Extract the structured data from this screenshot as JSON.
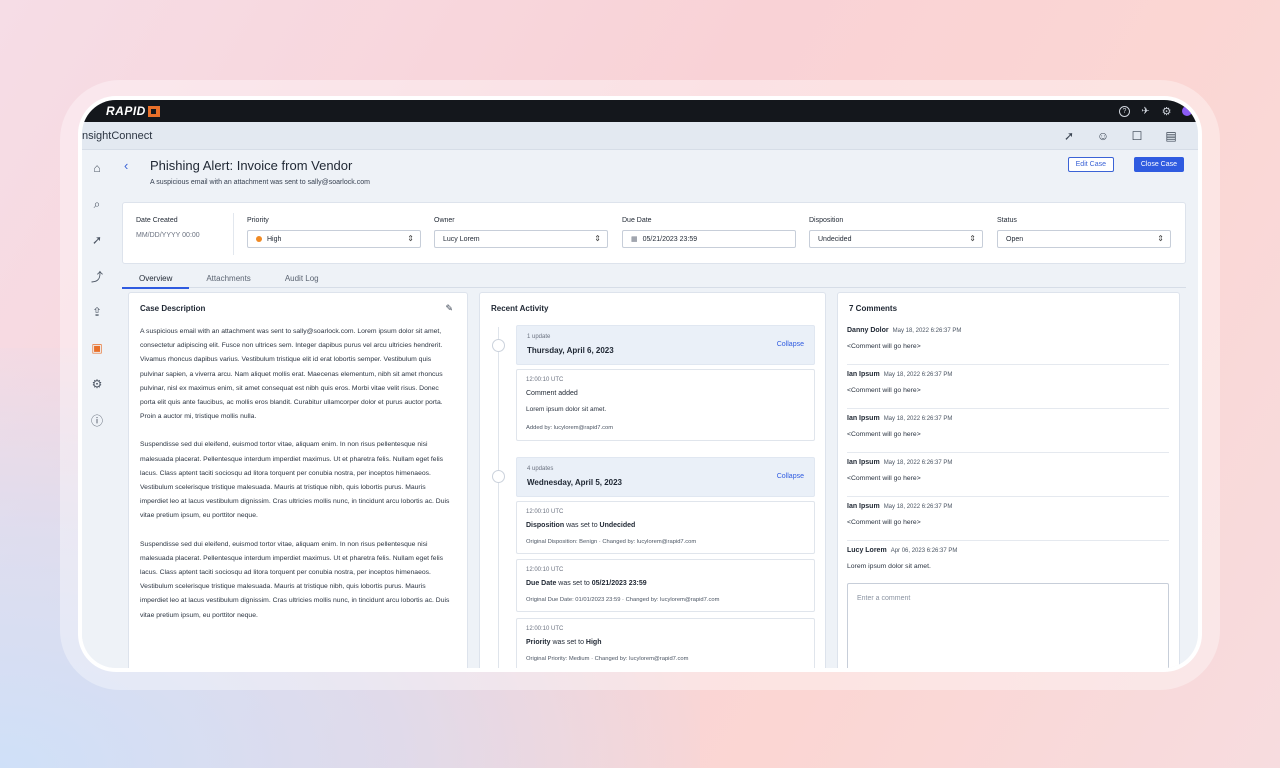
{
  "topbar": {
    "logo": "RAPID",
    "icons": [
      "help-icon",
      "rocket-icon",
      "settings-icon"
    ]
  },
  "app": {
    "name": "nsightConnect",
    "header_icons": [
      "cursor-icon",
      "user-add-icon",
      "chat-icon",
      "keyboard-icon"
    ]
  },
  "sidebar": {
    "icons": [
      "home-icon",
      "search-icon",
      "cursor-icon",
      "workflow-icon",
      "export-icon",
      "briefcase-icon",
      "gear-icon",
      "help-icon"
    ],
    "active": "briefcase-icon"
  },
  "case": {
    "title": "Phishing Alert: Invoice from Vendor",
    "subtitle": "A suspicious email with an attachment was sent to sally@soarlock.com",
    "edit_label": "Edit Case",
    "close_label": "Close Case"
  },
  "fields": {
    "date_created_label": "Date Created",
    "date_created_value": "MM/DD/YYYY 00:00",
    "priority_label": "Priority",
    "priority_value": "High",
    "priority_color": "#f08a24",
    "owner_label": "Owner",
    "owner_value": "Lucy Lorem",
    "due_label": "Due Date",
    "due_value": "05/21/2023 23:59",
    "disposition_label": "Disposition",
    "disposition_value": "Undecided",
    "status_label": "Status",
    "status_value": "Open"
  },
  "tabs": [
    "Overview",
    "Attachments",
    "Audit Log"
  ],
  "description": {
    "title": "Case Description",
    "paragraphs": [
      "A suspicious email with an attachment was sent to sally@soarlock.com. Lorem ipsum dolor sit amet, consectetur adipiscing elit. Fusce non ultrices sem. Integer dapibus purus vel arcu ultricies hendrerit. Vivamus rhoncus dapibus varius. Vestibulum tristique elit id erat lobortis semper. Vestibulum quis pulvinar sapien, a viverra arcu. Nam aliquet mollis erat. Maecenas elementum, nibh sit amet rhoncus pulvinar, nisl ex maximus enim, sit amet consequat est nibh quis eros. Morbi vitae velit risus. Donec porta elit quis ante faucibus, ac mollis eros blandit. Curabitur ullamcorper dolor et purus auctor porta. Proin a auctor mi, tristique mollis nulla.",
      "Suspendisse sed dui eleifend, euismod tortor vitae, aliquam enim. In non risus pellentesque nisi malesuada placerat. Pellentesque interdum imperdiet maximus. Ut et pharetra felis. Nullam eget felis lacus. Class aptent taciti sociosqu ad litora torquent per conubia nostra, per inceptos himenaeos. Vestibulum scelerisque tristique malesuada. Mauris at tristique nibh, quis lobortis purus. Mauris imperdiet leo at lacus vestibulum dignissim. Cras ultricies mollis nunc, in tincidunt arcu lobortis ac. Duis vitae pretium ipsum, eu porttitor neque.",
      "Suspendisse sed dui eleifend, euismod tortor vitae, aliquam enim. In non risus pellentesque nisi malesuada placerat. Pellentesque interdum imperdiet maximus. Ut et pharetra felis. Nullam eget felis lacus. Class aptent taciti sociosqu ad litora torquent per conubia nostra, per inceptos himenaeos. Vestibulum scelerisque tristique malesuada. Mauris at tristique nibh, quis lobortis purus. Mauris imperdiet leo at lacus vestibulum dignissim. Cras ultricies mollis nunc, in tincidunt arcu lobortis ac. Duis vitae pretium ipsum, eu porttitor neque."
    ]
  },
  "activity": {
    "title": "Recent Activity",
    "collapse_label": "Collapse",
    "group1": {
      "count": "1 update",
      "date": "Thursday, April 6, 2023",
      "entry": {
        "time": "12:00:10 UTC",
        "head": "Comment added",
        "body": "Lorem ipsum dolor sit amet.",
        "meta": "Added by: lucylorem@rapid7.com"
      }
    },
    "group2": {
      "count": "4 updates",
      "date": "Wednesday, April 5, 2023",
      "entries": [
        {
          "time": "12:00:10 UTC",
          "head_pre": "Disposition",
          "head_mid": " was set to ",
          "head_val": "Undecided",
          "meta": "Original Disposition: Benign  ·  Changed by: lucylorem@rapid7.com"
        },
        {
          "time": "12:00:10 UTC",
          "head_pre": "Due Date",
          "head_mid": " was set to ",
          "head_val": "05/21/2023 23:59",
          "meta": "Original Due Date: 01/01/2023 23:59  ·  Changed by: lucylorem@rapid7.com"
        },
        {
          "time": "12:00:10 UTC",
          "head_pre": "Priority",
          "head_mid": " was set to ",
          "head_val": "High",
          "meta": "Original Priority: Medium  ·  Changed by: lucylorem@rapid7.com"
        }
      ]
    }
  },
  "comments": {
    "title": "7 Comments",
    "items": [
      {
        "name": "Danny Dolor",
        "date": "May 18, 2022 6:26:37 PM",
        "text": "<Comment will go here>"
      },
      {
        "name": "Ian Ipsum",
        "date": "May 18, 2022 6:26:37 PM",
        "text": "<Comment will go here>"
      },
      {
        "name": "Ian Ipsum",
        "date": "May 18, 2022 6:26:37 PM",
        "text": "<Comment will go here>"
      },
      {
        "name": "Ian Ipsum",
        "date": "May 18, 2022 6:26:37 PM",
        "text": "<Comment will go here>"
      },
      {
        "name": "Ian Ipsum",
        "date": "May 18, 2022 6:26:37 PM",
        "text": "<Comment will go here>"
      },
      {
        "name": "Lucy Lorem",
        "date": "Apr 06, 2023 6:26:37 PM",
        "text": "Lorem ipsum dolor sit amet."
      }
    ],
    "input_placeholder": "Enter a comment"
  }
}
